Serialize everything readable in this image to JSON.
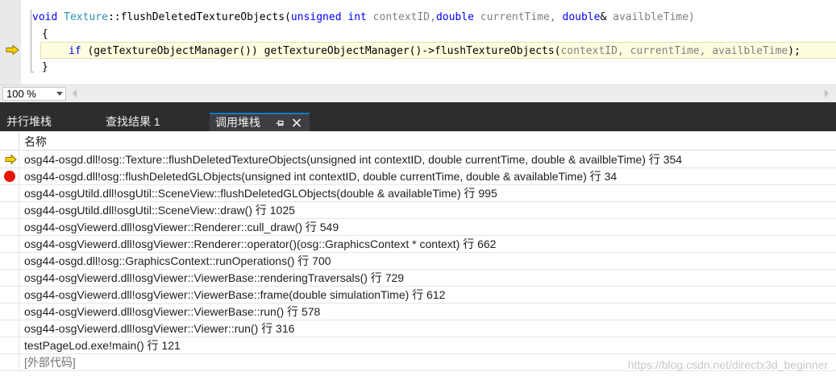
{
  "editor": {
    "line1": {
      "kw_void": "void",
      "class_name": "Texture",
      "func_sig": "::flushDeletedTextureObjects(",
      "kw_unsigned": "unsigned",
      "kw_int1": "int",
      "p_context": " contextID,",
      "kw_double1": "double",
      "p_time": " currentTime, ",
      "kw_double2": "double",
      "amp": "& ",
      "p_avail": "availbleTime)"
    },
    "line2": "{",
    "line3": {
      "kw_if": "if",
      "body": " (getTextureObjectManager()) getTextureObjectManager()->flushTextureObjects(",
      "args": "contextID, currentTime, availbleTime",
      "end": ");"
    },
    "line4": "}"
  },
  "zoom": {
    "value": "100 %"
  },
  "tabs": {
    "parallel_stacks": "并行堆栈",
    "find_results": "查找结果 1",
    "call_stack": "调用堆栈"
  },
  "callstack": {
    "column_header": "名称",
    "rows": [
      {
        "text": "osg44-osgd.dll!osg::Texture::flushDeletedTextureObjects(unsigned int contextID, double currentTime, double & availbleTime) 行 354",
        "marker": "current"
      },
      {
        "text": "osg44-osgd.dll!osg::flushDeletedGLObjects(unsigned int contextID, double currentTime, double & availableTime) 行 34",
        "marker": "breakpoint"
      },
      {
        "text": "osg44-osgUtild.dll!osgUtil::SceneView::flushDeletedGLObjects(double & availableTime) 行 995",
        "marker": ""
      },
      {
        "text": "osg44-osgUtild.dll!osgUtil::SceneView::draw() 行 1025",
        "marker": ""
      },
      {
        "text": "osg44-osgViewerd.dll!osgViewer::Renderer::cull_draw() 行 549",
        "marker": ""
      },
      {
        "text": "osg44-osgViewerd.dll!osgViewer::Renderer::operator()(osg::GraphicsContext * context) 行 662",
        "marker": ""
      },
      {
        "text": "osg44-osgd.dll!osg::GraphicsContext::runOperations() 行 700",
        "marker": ""
      },
      {
        "text": "osg44-osgViewerd.dll!osgViewer::ViewerBase::renderingTraversals() 行 729",
        "marker": ""
      },
      {
        "text": "osg44-osgViewerd.dll!osgViewer::ViewerBase::frame(double simulationTime) 行 612",
        "marker": ""
      },
      {
        "text": "osg44-osgViewerd.dll!osgViewer::ViewerBase::run() 行 578",
        "marker": ""
      },
      {
        "text": "osg44-osgViewerd.dll!osgViewer::Viewer::run() 行 316",
        "marker": ""
      },
      {
        "text": "testPageLod.exe!main() 行 121",
        "marker": ""
      },
      {
        "text": "[外部代码]",
        "marker": "external"
      }
    ]
  },
  "watermark": "https://blog.csdn.net/directx3d_beginner",
  "colors": {
    "keyword": "#0000ff",
    "type": "#2b91af",
    "parameter": "#7f7f7f",
    "tab_bar": "#2d2d30",
    "active_tab_accent": "#007acc",
    "breakpoint": "#e51400",
    "current_arrow": "#f5d000"
  }
}
